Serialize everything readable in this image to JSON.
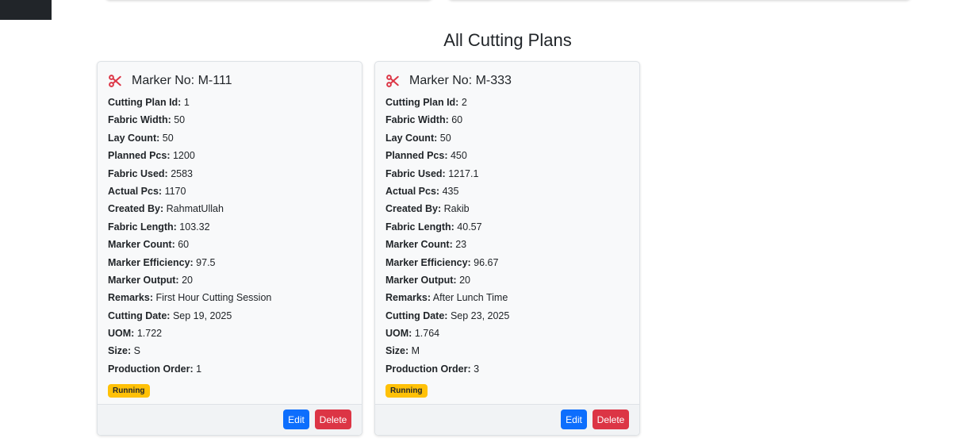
{
  "page": {
    "title": "All Cutting Plans"
  },
  "cards": [
    {
      "title": "Marker No: M-111",
      "fields": [
        {
          "label": "Cutting Plan Id:",
          "value": "1"
        },
        {
          "label": "Fabric Width:",
          "value": "50"
        },
        {
          "label": "Lay Count:",
          "value": "50"
        },
        {
          "label": "Planned Pcs:",
          "value": "1200"
        },
        {
          "label": "Fabric Used:",
          "value": "2583"
        },
        {
          "label": "Actual Pcs:",
          "value": "1170"
        },
        {
          "label": "Created By:",
          "value": "RahmatUllah"
        },
        {
          "label": "Fabric Length:",
          "value": "103.32"
        },
        {
          "label": "Marker Count:",
          "value": "60"
        },
        {
          "label": "Marker Efficiency:",
          "value": "97.5"
        },
        {
          "label": "Marker Output:",
          "value": "20"
        },
        {
          "label": "Remarks:",
          "value": "First Hour Cutting Session"
        },
        {
          "label": "Cutting Date:",
          "value": "Sep 19, 2025"
        },
        {
          "label": "UOM:",
          "value": "1.722"
        },
        {
          "label": "Size:",
          "value": "S"
        },
        {
          "label": "Production Order:",
          "value": "1"
        }
      ],
      "status": "Running",
      "edit_label": "Edit",
      "delete_label": "Delete"
    },
    {
      "title": "Marker No: M-333",
      "fields": [
        {
          "label": "Cutting Plan Id:",
          "value": "2"
        },
        {
          "label": "Fabric Width:",
          "value": "60"
        },
        {
          "label": "Lay Count:",
          "value": "50"
        },
        {
          "label": "Planned Pcs:",
          "value": "450"
        },
        {
          "label": "Fabric Used:",
          "value": "1217.1"
        },
        {
          "label": "Actual Pcs:",
          "value": "435"
        },
        {
          "label": "Created By:",
          "value": "Rakib"
        },
        {
          "label": "Fabric Length:",
          "value": "40.57"
        },
        {
          "label": "Marker Count:",
          "value": "23"
        },
        {
          "label": "Marker Efficiency:",
          "value": "96.67"
        },
        {
          "label": "Marker Output:",
          "value": "20"
        },
        {
          "label": "Remarks:",
          "value": "After Lunch Time"
        },
        {
          "label": "Cutting Date:",
          "value": "Sep 23, 2025"
        },
        {
          "label": "UOM:",
          "value": "1.764"
        },
        {
          "label": "Size:",
          "value": "M"
        },
        {
          "label": "Production Order:",
          "value": "3"
        }
      ],
      "status": "Running",
      "edit_label": "Edit",
      "delete_label": "Delete"
    }
  ],
  "colors": {
    "icon": "#dc3545",
    "badge": "#ffc107",
    "edit_button": "#0d6efd",
    "delete_button": "#dc3545"
  },
  "icons": {
    "card_icon": "scissors-icon"
  }
}
